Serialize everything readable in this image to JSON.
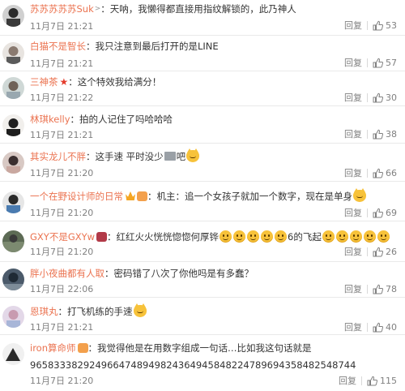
{
  "ui": {
    "reply_label": "回复",
    "separator": "：",
    "username_color": "#eb7350"
  },
  "comments": [
    {
      "username": "苏苏苏苏苏Suk",
      "text": "天呐，我懒得都直接用指纹解锁的，此乃神人",
      "time": "11月7日 21:21",
      "likes": "53"
    },
    {
      "username": "白猫不是智长",
      "text": "我只注意到最后打开的是LINE",
      "time": "11月7日 21:21",
      "likes": "57"
    },
    {
      "username": "三神茶",
      "text": "这个特效我给满分！",
      "time": "11月7日 21:22",
      "likes": "30"
    },
    {
      "username": "林琪kelly",
      "text": "拍的人记住了吗哈哈哈",
      "time": "11月7日 21:21",
      "likes": "38"
    },
    {
      "username": "其实龙儿不胖",
      "text_a": "这手速 平时没少",
      "text_b": "吧",
      "time": "11月7日 21:20",
      "likes": "66"
    },
    {
      "username": "一个在野设计师的日常",
      "text": "机主：追一个女孩子就加一个数字，现在是单身",
      "time": "11月7日 21:20",
      "likes": "69"
    },
    {
      "username": "GXY不是GXYw",
      "text_a": "红红火火恍恍惚惚何厚铧",
      "text_b": "6的飞起",
      "time": "11月7日 21:20",
      "likes": "26"
    },
    {
      "username": "胖小夜曲都有人取",
      "text": "密码错了八次了你他吗是有多蠢？",
      "time": "11月7日 22:06",
      "likes": "78"
    },
    {
      "username": "恩琪丸",
      "text": "打飞机练的手速",
      "time": "11月7日 21:21",
      "likes": "40"
    },
    {
      "username": "iron算命师",
      "text": "我觉得他是在用数字组成一句话…比如我这句话就是",
      "text_line2": "9658333829249664748949824364945848224789694358482548744",
      "time": "11月7日 21:20",
      "likes": "115"
    }
  ]
}
